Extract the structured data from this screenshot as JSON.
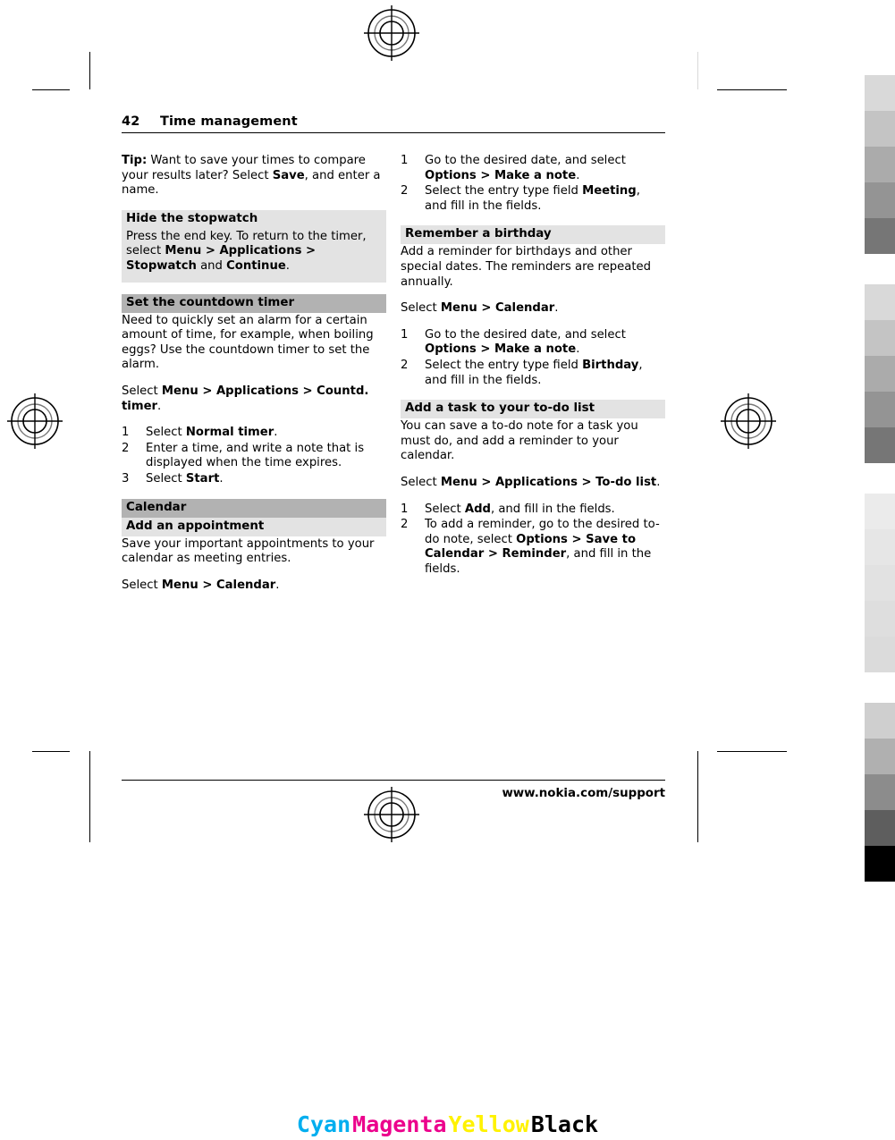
{
  "document": {
    "folio": "42",
    "running_head": "Time management",
    "footer_url": "www.nokia.com/support"
  },
  "left_column": {
    "tip": {
      "label": "Tip:",
      "text_1": " Want to save your times to compare your results later? Select ",
      "bold_1": "Save",
      "text_2": ", and enter a name."
    },
    "hide_stopwatch": {
      "heading": "Hide the stopwatch",
      "text_1": "Press the end key. To return to the timer, select ",
      "bold_menu": "Menu",
      "sep_1": " > ",
      "bold_applications": "Applications",
      "sep_2": " > ",
      "bold_stopwatch": "Stopwatch",
      "text_and": " and ",
      "bold_continue": "Continue",
      "text_end": "."
    },
    "countdown": {
      "heading": "Set the countdown timer",
      "intro": "Need to quickly set an alarm for a certain amount of time, for example, when boiling eggs? Use the countdown timer to set the alarm.",
      "select_prefix": "Select ",
      "bold_menu": "Menu",
      "sep_1": " > ",
      "bold_applications": "Applications",
      "sep_2": " > ",
      "bold_countdtimer": "Countd. timer",
      "select_end": ".",
      "steps": [
        {
          "num": "1",
          "pre": "Select ",
          "bold": "Normal timer",
          "post": "."
        },
        {
          "num": "2",
          "pre": "Enter a time, and write a note that is displayed when the time expires.",
          "bold": "",
          "post": ""
        },
        {
          "num": "3",
          "pre": "Select ",
          "bold": "Start",
          "post": "."
        }
      ]
    },
    "calendar": {
      "section_heading": "Calendar",
      "sub_heading": "Add an appointment",
      "intro": "Save your important appointments to your calendar as meeting entries.",
      "select_prefix": "Select ",
      "bold_menu": "Menu",
      "sep_1": " > ",
      "bold_calendar": "Calendar",
      "select_end": "."
    }
  },
  "right_column": {
    "appointment_steps": [
      {
        "num": "1",
        "pre": "Go to the desired date, and select ",
        "bold_a": "Options",
        "sep": " > ",
        "bold_b": "Make a note",
        "post": "."
      },
      {
        "num": "2",
        "pre": "Select the entry type field ",
        "bold_a": "Meeting",
        "sep": "",
        "bold_b": "",
        "post": ", and fill in the fields."
      }
    ],
    "birthday": {
      "heading": "Remember a birthday",
      "intro": "Add a reminder for birthdays and other special dates. The reminders are repeated annually.",
      "select_prefix": "Select ",
      "bold_menu": "Menu",
      "sep_1": " > ",
      "bold_calendar": "Calendar",
      "select_end": ".",
      "steps": [
        {
          "num": "1",
          "pre": "Go to the desired date, and select ",
          "bold_a": "Options",
          "sep": " > ",
          "bold_b": "Make a note",
          "post": "."
        },
        {
          "num": "2",
          "pre": "Select the entry type field ",
          "bold_a": "Birthday",
          "sep": "",
          "bold_b": "",
          "post": ", and fill in the fields."
        }
      ]
    },
    "todo": {
      "heading": "Add a task to your to-do list",
      "intro": "You can save a to-do note for a task you must do, and add a reminder to your calendar.",
      "select_prefix": "Select ",
      "bold_menu": "Menu",
      "sep_1": " > ",
      "bold_applications": "Applications",
      "sep_2": " > ",
      "bold_todolist": "To-do list",
      "select_end": ".",
      "steps": [
        {
          "num": "1",
          "pre": "Select ",
          "bold_a": "Add",
          "sep": "",
          "bold_b": "",
          "post": ", and fill in the fields."
        },
        {
          "num": "2",
          "pre": "To add a reminder, go to the desired to-do note, select ",
          "bold_a": "Options",
          "sep": " > ",
          "bold_b": "Save to Calendar",
          "sep_2": " > ",
          "bold_c": "Reminder",
          "post": ", and fill in the fields."
        }
      ]
    }
  },
  "press_marks": {
    "cmyk_legend": [
      {
        "label": "Cyan",
        "color": "#00AEEF"
      },
      {
        "label": "Magenta",
        "color": "#EC008C"
      },
      {
        "label": "Yellow",
        "color": "#FFF200"
      },
      {
        "label": "Black",
        "color": "#000000"
      }
    ],
    "grayscale_strip": {
      "group_1": [
        "#d9d9d9",
        "#c4c4c4",
        "#ababab",
        "#949494",
        "#767676"
      ],
      "group_2": [
        "#d9d9d9",
        "#c4c4c4",
        "#ababab",
        "#949494",
        "#767676"
      ],
      "group_3": [
        "#ebebeb",
        "#e6e6e6",
        "#e2e2e2",
        "#dedede",
        "#dbdbdb"
      ],
      "group_4": [
        "#cfcfcf",
        "#b0b0b0",
        "#8c8c8c",
        "#5e5e5e",
        "#000000"
      ]
    }
  }
}
